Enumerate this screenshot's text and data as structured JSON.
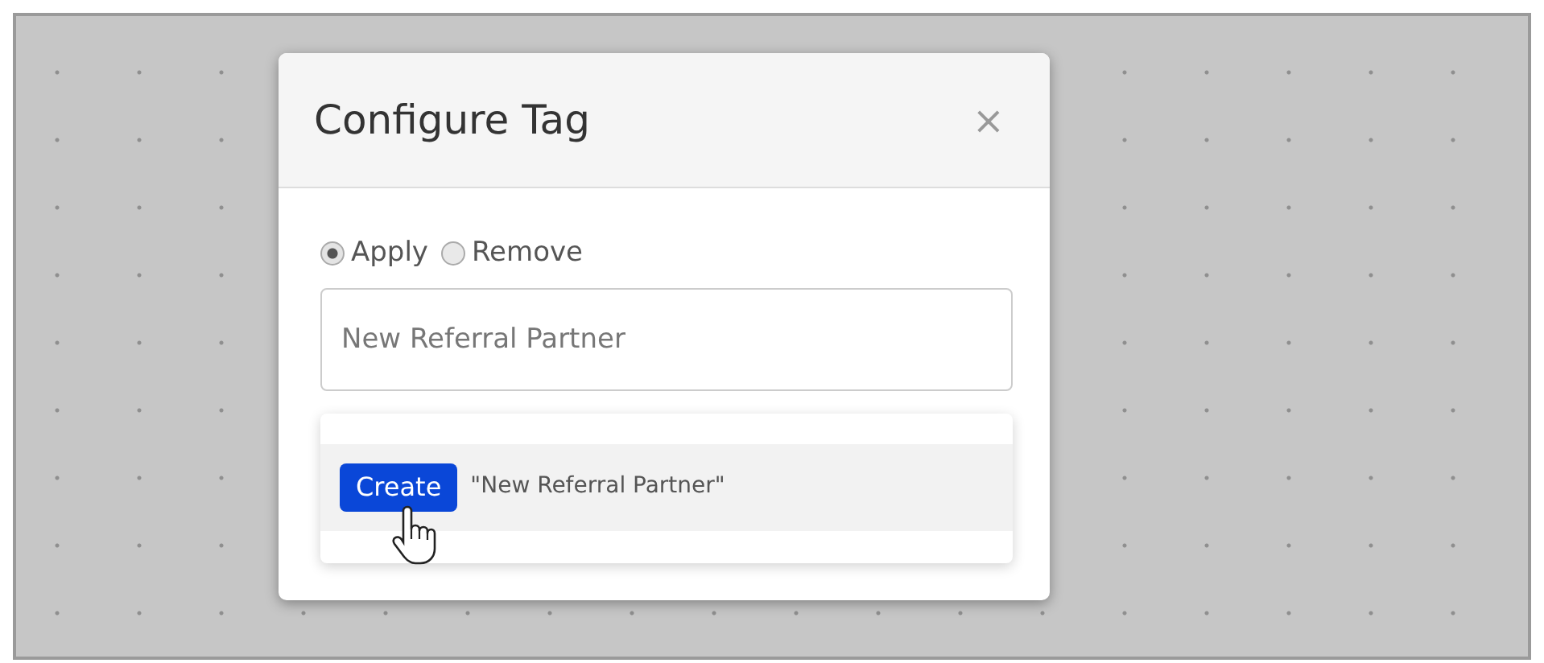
{
  "dialog": {
    "title": "Configure Tag",
    "close": "×"
  },
  "options": [
    {
      "label": "Apply",
      "selected": true
    },
    {
      "label": "Remove",
      "selected": false
    }
  ],
  "tag_field": {
    "value": "New Referral Partner"
  },
  "suggestions": [
    {
      "button": "Create",
      "text": "\"New Referral Partner\"",
      "highlighted": true
    }
  ]
}
